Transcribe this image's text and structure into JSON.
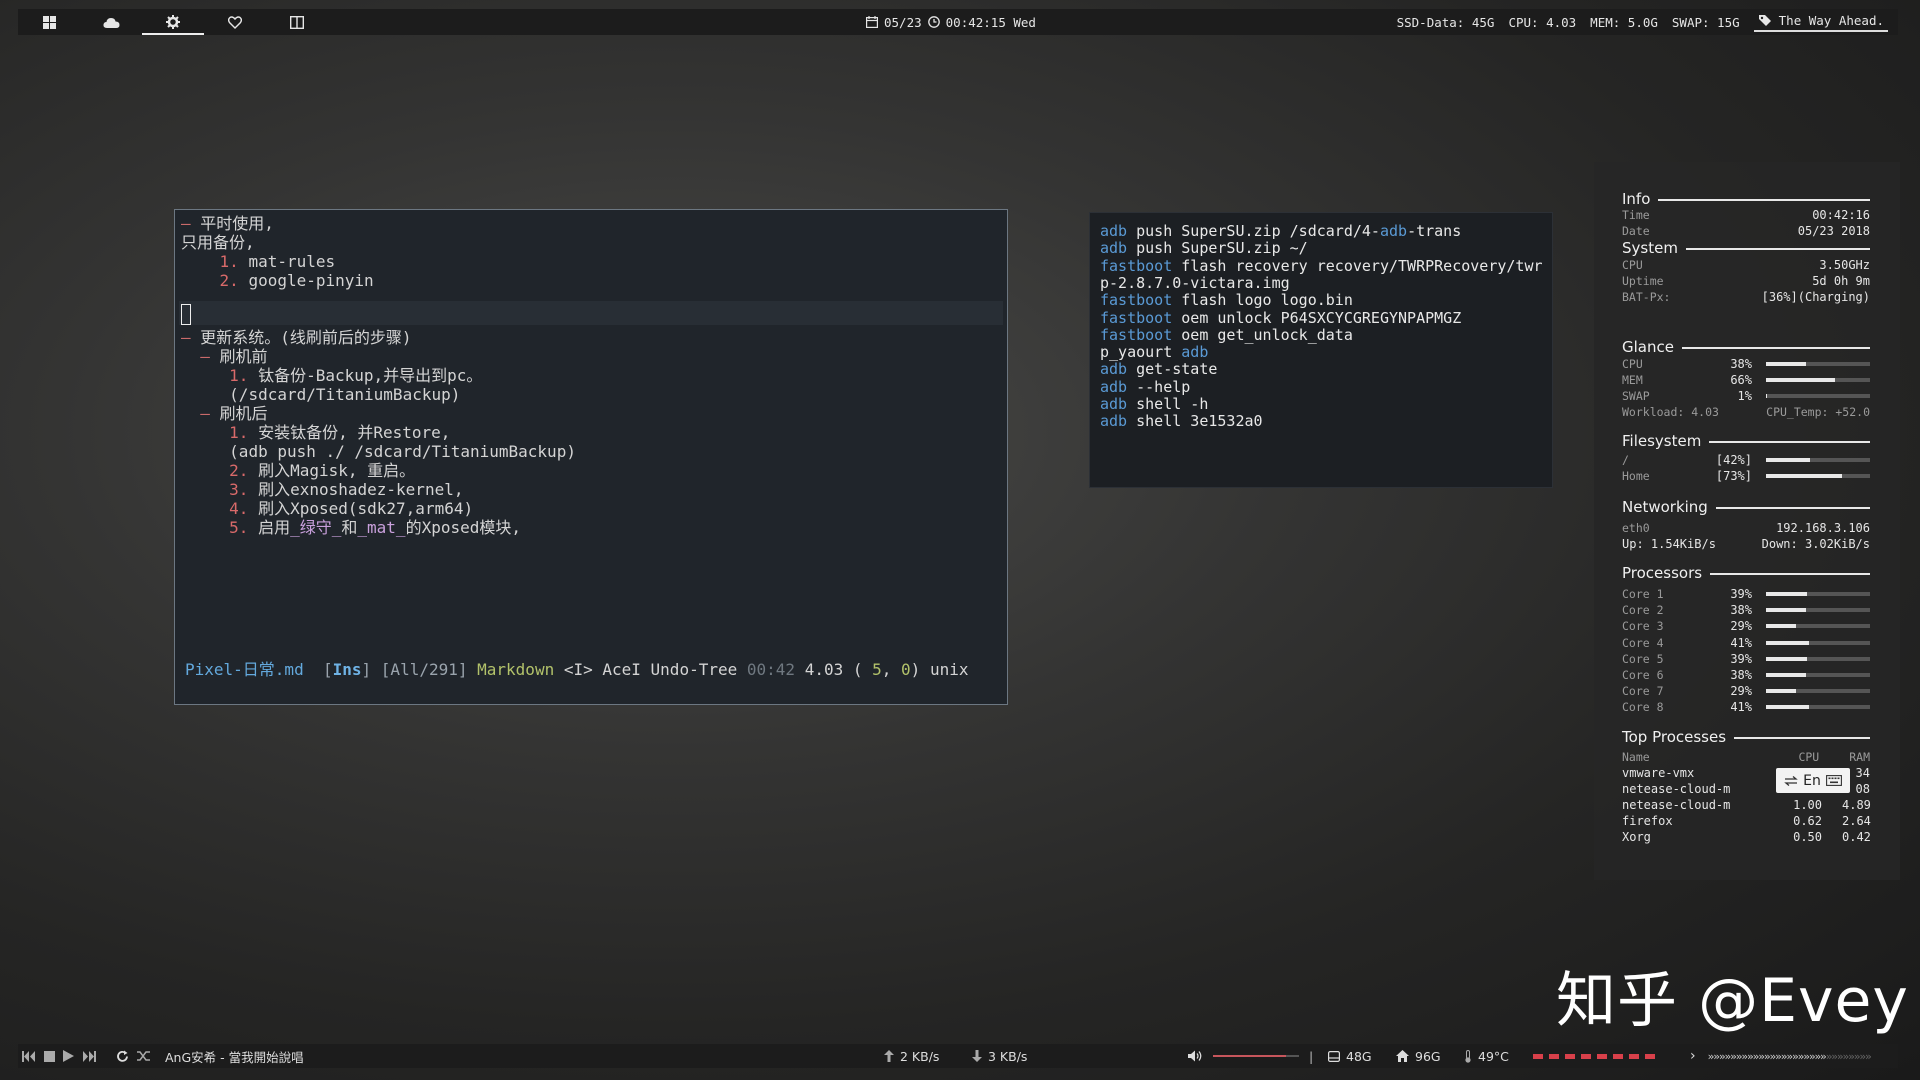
{
  "topbar": {
    "workspaces": [
      "windows-icon",
      "cloud-icon",
      "gear-icon",
      "heart-icon",
      "split-icon"
    ],
    "active_workspace": 2,
    "date": "05/23",
    "time": "00:42:15 Wed",
    "ssd": "SSD-Data: 45G",
    "cpu": "CPU: 4.03",
    "mem": "MEM: 5.0G",
    "swap": "SWAP: 15G",
    "quote": "The Way Ahead."
  },
  "editor": {
    "lines": [
      {
        "dash": "– ",
        "text": "平时使用,"
      },
      {
        "text": "只用备份,"
      },
      {
        "indent": "    ",
        "num": "1. ",
        "text": "mat-rules"
      },
      {
        "indent": "    ",
        "num": "2. ",
        "text": "google-pinyin"
      },
      {
        "text": ""
      },
      {
        "text": ""
      },
      {
        "dash": "– ",
        "text": "更新系统。(线刷前后的步骤)"
      },
      {
        "indent": "  ",
        "dash": "– ",
        "text": "刷机前"
      },
      {
        "indent": "     ",
        "num": "1. ",
        "text": "钛备份-Backup,并导出到pc。"
      },
      {
        "indent": "     ",
        "text": "(/sdcard/TitaniumBackup)"
      },
      {
        "indent": "  ",
        "dash": "– ",
        "text": "刷机后"
      },
      {
        "indent": "     ",
        "num": "1. ",
        "text": "安装钛备份, 并Restore,"
      },
      {
        "indent": "     ",
        "text": "(adb push ./ /sdcard/TitaniumBackup)"
      },
      {
        "indent": "     ",
        "num": "2. ",
        "text": "刷入Magisk, 重启。"
      },
      {
        "indent": "     ",
        "num": "3. ",
        "text": "刷入exnoshadez-kernel,"
      },
      {
        "indent": "     ",
        "num": "4. ",
        "text": "刷入Xposed(sdk27,arm64)"
      },
      {
        "indent": "     ",
        "num": "5. ",
        "text_a": "启用",
        "mag_a": "_绿守_",
        "text_b": "和",
        "mag_b": "_mat_",
        "text_c": "的Xposed模块,"
      }
    ],
    "status": {
      "file": "Pixel-日常.md",
      "mode": "Ins",
      "pos": "[All/291]",
      "filetype": "Markdown",
      "flags": "<I> AceI Undo-Tree",
      "clock": "00:42",
      "load": "4.03",
      "cursor_l": "5",
      "cursor_c": "0",
      "format": "unix"
    }
  },
  "terminal": {
    "lines": [
      {
        "cmd": "adb",
        "rest": " push SuperSU.zip /sdcard/4-",
        "cmd2": "adb",
        "rest2": "-trans"
      },
      {
        "cmd": "adb",
        "rest": " push SuperSU.zip ~/"
      },
      {
        "cmd": "fastboot",
        "rest": " flash recovery recovery/TWRPRecovery/twr"
      },
      {
        "cmd": "",
        "rest": "p-2.8.7.0-victara.img"
      },
      {
        "cmd": "fastboot",
        "rest": " flash logo logo.bin"
      },
      {
        "cmd": "fastboot",
        "rest": " oem unlock P64SXCYCGREGYNPAPMGZ"
      },
      {
        "cmd": "fastboot",
        "rest": " oem get_unlock_data"
      },
      {
        "cmd": "",
        "rest": "p_yaourt ",
        "cmd2": "adb"
      },
      {
        "cmd": "adb",
        "rest": " get-state"
      },
      {
        "cmd": "adb",
        "rest": " --help"
      },
      {
        "cmd": "adb",
        "rest": " shell -h"
      },
      {
        "cmd": "adb",
        "rest": " shell 3e1532a0"
      }
    ]
  },
  "conky": {
    "info_title": "Info",
    "time_label": "Time",
    "time": "00:42:16",
    "date_label": "Date",
    "date": "05/23 2018",
    "system_title": "System",
    "cpu_label": "CPU",
    "cpu": "3.50GHz",
    "uptime_label": "Uptime",
    "uptime": "5d 0h 9m",
    "bat_label": "BAT-Px:",
    "bat": "[36%](Charging)",
    "glance_title": "Glance",
    "glance": [
      {
        "label": "CPU",
        "pct": "38%",
        "fill": 0.38
      },
      {
        "label": "MEM",
        "pct": "66%",
        "fill": 0.66
      },
      {
        "label": "SWAP",
        "pct": "1%",
        "fill": 0.01
      }
    ],
    "workload": "Workload: 4.03",
    "cpu_temp": "CPU_Temp: +52.0",
    "fs_title": "Filesystem",
    "fs": [
      {
        "label": "/",
        "pct": "[42%]",
        "fill": 0.42
      },
      {
        "label": "Home",
        "pct": "[73%]",
        "fill": 0.73
      }
    ],
    "net_title": "Networking",
    "eth_label": "eth0",
    "ip": "192.168.3.106",
    "up": "Up: 1.54KiB/s",
    "down": "Down: 3.02KiB/s",
    "proc_title": "Processors",
    "cores": [
      {
        "label": "Core 1",
        "pct": "39%",
        "fill": 0.39
      },
      {
        "label": "Core 2",
        "pct": "38%",
        "fill": 0.38
      },
      {
        "label": "Core 3",
        "pct": "29%",
        "fill": 0.29
      },
      {
        "label": "Core 4",
        "pct": "41%",
        "fill": 0.41
      },
      {
        "label": "Core 5",
        "pct": "39%",
        "fill": 0.39
      },
      {
        "label": "Core 6",
        "pct": "38%",
        "fill": 0.38
      },
      {
        "label": "Core 7",
        "pct": "29%",
        "fill": 0.29
      },
      {
        "label": "Core 8",
        "pct": "41%",
        "fill": 0.41
      }
    ],
    "top_title": "Top Processes",
    "top_headers": {
      "name": "Name",
      "cpu": "CPU",
      "ram": "RAM"
    },
    "top": [
      {
        "name": "vmware-vmx",
        "cpu": "",
        "ram": "34"
      },
      {
        "name": "netease-cloud-m",
        "cpu": "",
        "ram": "08"
      },
      {
        "name": "netease-cloud-m",
        "cpu": "1.00",
        "ram": "4.89"
      },
      {
        "name": "firefox",
        "cpu": "0.62",
        "ram": "2.64"
      },
      {
        "name": "Xorg",
        "cpu": "0.50",
        "ram": "0.42"
      }
    ]
  },
  "ime": {
    "label": "En"
  },
  "watermark": "知乎 @Evey",
  "bottombar": {
    "song": "AnG安希 - 當我開始說唱",
    "up_speed": "2 KB/s",
    "down_speed": "3 KB/s",
    "volume": 0.85,
    "disk1": "48G",
    "disk2": "96G",
    "temp": "49°C",
    "arrows": "»»»»»»»»»»»»»»»»»»»»»",
    "arrows_faded": "»»»»»»»»"
  },
  "colors": {
    "accent_red": "#d8404a",
    "cmd_blue": "#5a9ad5",
    "list_red": "#d96a6a"
  }
}
